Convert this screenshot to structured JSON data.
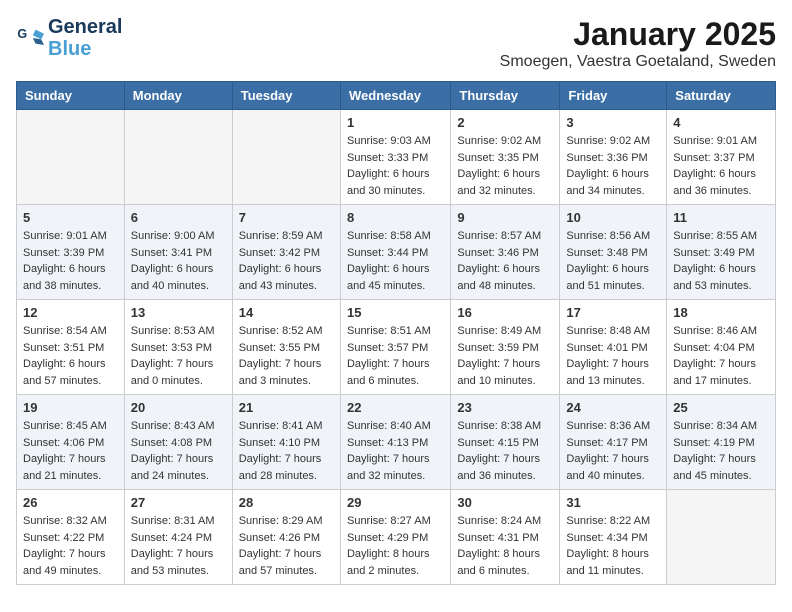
{
  "logo": {
    "line1": "General",
    "line2": "Blue"
  },
  "title": "January 2025",
  "subtitle": "Smoegen, Vaestra Goetaland, Sweden",
  "weekdays": [
    "Sunday",
    "Monday",
    "Tuesday",
    "Wednesday",
    "Thursday",
    "Friday",
    "Saturday"
  ],
  "weeks": [
    [
      {
        "day": "",
        "info": ""
      },
      {
        "day": "",
        "info": ""
      },
      {
        "day": "",
        "info": ""
      },
      {
        "day": "1",
        "info": "Sunrise: 9:03 AM\nSunset: 3:33 PM\nDaylight: 6 hours\nand 30 minutes."
      },
      {
        "day": "2",
        "info": "Sunrise: 9:02 AM\nSunset: 3:35 PM\nDaylight: 6 hours\nand 32 minutes."
      },
      {
        "day": "3",
        "info": "Sunrise: 9:02 AM\nSunset: 3:36 PM\nDaylight: 6 hours\nand 34 minutes."
      },
      {
        "day": "4",
        "info": "Sunrise: 9:01 AM\nSunset: 3:37 PM\nDaylight: 6 hours\nand 36 minutes."
      }
    ],
    [
      {
        "day": "5",
        "info": "Sunrise: 9:01 AM\nSunset: 3:39 PM\nDaylight: 6 hours\nand 38 minutes."
      },
      {
        "day": "6",
        "info": "Sunrise: 9:00 AM\nSunset: 3:41 PM\nDaylight: 6 hours\nand 40 minutes."
      },
      {
        "day": "7",
        "info": "Sunrise: 8:59 AM\nSunset: 3:42 PM\nDaylight: 6 hours\nand 43 minutes."
      },
      {
        "day": "8",
        "info": "Sunrise: 8:58 AM\nSunset: 3:44 PM\nDaylight: 6 hours\nand 45 minutes."
      },
      {
        "day": "9",
        "info": "Sunrise: 8:57 AM\nSunset: 3:46 PM\nDaylight: 6 hours\nand 48 minutes."
      },
      {
        "day": "10",
        "info": "Sunrise: 8:56 AM\nSunset: 3:48 PM\nDaylight: 6 hours\nand 51 minutes."
      },
      {
        "day": "11",
        "info": "Sunrise: 8:55 AM\nSunset: 3:49 PM\nDaylight: 6 hours\nand 53 minutes."
      }
    ],
    [
      {
        "day": "12",
        "info": "Sunrise: 8:54 AM\nSunset: 3:51 PM\nDaylight: 6 hours\nand 57 minutes."
      },
      {
        "day": "13",
        "info": "Sunrise: 8:53 AM\nSunset: 3:53 PM\nDaylight: 7 hours\nand 0 minutes."
      },
      {
        "day": "14",
        "info": "Sunrise: 8:52 AM\nSunset: 3:55 PM\nDaylight: 7 hours\nand 3 minutes."
      },
      {
        "day": "15",
        "info": "Sunrise: 8:51 AM\nSunset: 3:57 PM\nDaylight: 7 hours\nand 6 minutes."
      },
      {
        "day": "16",
        "info": "Sunrise: 8:49 AM\nSunset: 3:59 PM\nDaylight: 7 hours\nand 10 minutes."
      },
      {
        "day": "17",
        "info": "Sunrise: 8:48 AM\nSunset: 4:01 PM\nDaylight: 7 hours\nand 13 minutes."
      },
      {
        "day": "18",
        "info": "Sunrise: 8:46 AM\nSunset: 4:04 PM\nDaylight: 7 hours\nand 17 minutes."
      }
    ],
    [
      {
        "day": "19",
        "info": "Sunrise: 8:45 AM\nSunset: 4:06 PM\nDaylight: 7 hours\nand 21 minutes."
      },
      {
        "day": "20",
        "info": "Sunrise: 8:43 AM\nSunset: 4:08 PM\nDaylight: 7 hours\nand 24 minutes."
      },
      {
        "day": "21",
        "info": "Sunrise: 8:41 AM\nSunset: 4:10 PM\nDaylight: 7 hours\nand 28 minutes."
      },
      {
        "day": "22",
        "info": "Sunrise: 8:40 AM\nSunset: 4:13 PM\nDaylight: 7 hours\nand 32 minutes."
      },
      {
        "day": "23",
        "info": "Sunrise: 8:38 AM\nSunset: 4:15 PM\nDaylight: 7 hours\nand 36 minutes."
      },
      {
        "day": "24",
        "info": "Sunrise: 8:36 AM\nSunset: 4:17 PM\nDaylight: 7 hours\nand 40 minutes."
      },
      {
        "day": "25",
        "info": "Sunrise: 8:34 AM\nSunset: 4:19 PM\nDaylight: 7 hours\nand 45 minutes."
      }
    ],
    [
      {
        "day": "26",
        "info": "Sunrise: 8:32 AM\nSunset: 4:22 PM\nDaylight: 7 hours\nand 49 minutes."
      },
      {
        "day": "27",
        "info": "Sunrise: 8:31 AM\nSunset: 4:24 PM\nDaylight: 7 hours\nand 53 minutes."
      },
      {
        "day": "28",
        "info": "Sunrise: 8:29 AM\nSunset: 4:26 PM\nDaylight: 7 hours\nand 57 minutes."
      },
      {
        "day": "29",
        "info": "Sunrise: 8:27 AM\nSunset: 4:29 PM\nDaylight: 8 hours\nand 2 minutes."
      },
      {
        "day": "30",
        "info": "Sunrise: 8:24 AM\nSunset: 4:31 PM\nDaylight: 8 hours\nand 6 minutes."
      },
      {
        "day": "31",
        "info": "Sunrise: 8:22 AM\nSunset: 4:34 PM\nDaylight: 8 hours\nand 11 minutes."
      },
      {
        "day": "",
        "info": ""
      }
    ]
  ]
}
